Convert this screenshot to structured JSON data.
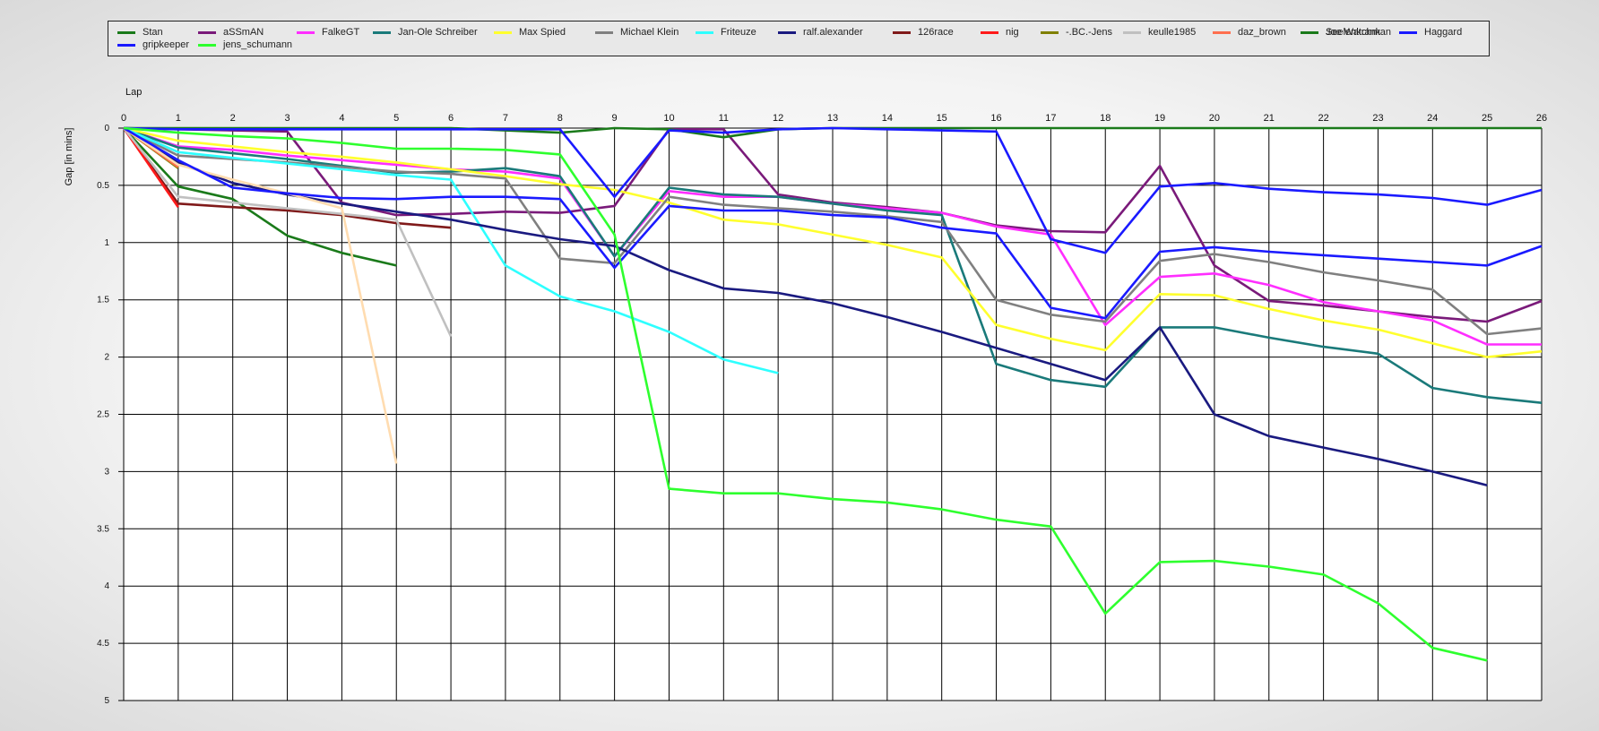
{
  "chart_data": {
    "type": "line",
    "xlabel": "Lap",
    "ylabel": "Gap [in mins]",
    "xlim": [
      0,
      26
    ],
    "ylim": [
      0,
      5
    ],
    "y_inverted": true,
    "grid": true,
    "legend_position": "top",
    "x_ticks": [
      "0",
      "1",
      "2",
      "3",
      "4",
      "5",
      "6",
      "7",
      "8",
      "9",
      "10",
      "11",
      "12",
      "13",
      "14",
      "15",
      "16",
      "17",
      "18",
      "19",
      "20",
      "21",
      "22",
      "23",
      "24",
      "25",
      "26"
    ],
    "y_ticks": [
      "0",
      "0.5",
      "1",
      "1.5",
      "2",
      "2.5",
      "3",
      "3.5",
      "4",
      "4.5",
      "5"
    ],
    "series": [
      {
        "name": "Stan",
        "color": "#1a7a1a",
        "x": [
          0,
          1,
          2,
          3,
          4,
          5
        ],
        "y": [
          0,
          0.51,
          0.62,
          0.94,
          1.09,
          1.2
        ]
      },
      {
        "name": "aSSmAN",
        "color": "#7a1a7a",
        "x": [
          0,
          1,
          2,
          3,
          4,
          5,
          6,
          7,
          8,
          9,
          10,
          11,
          12,
          13,
          14,
          15,
          16,
          17,
          18,
          19,
          20,
          21,
          22,
          23,
          24,
          25,
          26
        ],
        "y": [
          0,
          0.01,
          0.02,
          0.03,
          0.65,
          0.76,
          0.75,
          0.73,
          0.74,
          0.68,
          0.01,
          0.01,
          0.58,
          0.65,
          0.69,
          0.74,
          0.85,
          0.9,
          0.91,
          0.33,
          1.2,
          1.51,
          1.55,
          1.6,
          1.65,
          1.69,
          1.51
        ]
      },
      {
        "name": "FalkeGT",
        "color": "#ff2eff",
        "x": [
          0,
          1,
          2,
          3,
          4,
          5,
          6,
          7,
          8,
          9,
          10,
          11,
          12,
          13,
          14,
          15,
          16,
          17,
          18,
          19,
          20,
          21,
          22,
          23,
          24,
          25,
          26
        ],
        "y": [
          0,
          0.16,
          0.19,
          0.24,
          0.28,
          0.32,
          0.36,
          0.38,
          0.44,
          1.12,
          0.55,
          0.6,
          0.6,
          0.66,
          0.7,
          0.74,
          0.86,
          0.93,
          1.72,
          1.3,
          1.27,
          1.37,
          1.52,
          1.6,
          1.68,
          1.89,
          1.89
        ]
      },
      {
        "name": "Jan-Ole Schreiber",
        "color": "#1a7a7a",
        "x": [
          0,
          1,
          2,
          3,
          4,
          5,
          6,
          7,
          8,
          9,
          10,
          11,
          12,
          13,
          14,
          15,
          16,
          17,
          18,
          19,
          20,
          21,
          22,
          23,
          24,
          25,
          26
        ],
        "y": [
          0,
          0.17,
          0.22,
          0.27,
          0.33,
          0.39,
          0.38,
          0.35,
          0.42,
          1.12,
          0.52,
          0.58,
          0.6,
          0.66,
          0.72,
          0.76,
          2.06,
          2.2,
          2.26,
          1.74,
          1.74,
          1.83,
          1.91,
          1.97,
          2.27,
          2.35,
          2.4
        ]
      },
      {
        "name": "Max Spied",
        "color": "#ffff2e",
        "x": [
          0,
          1,
          2,
          3,
          4,
          5,
          6,
          7,
          8,
          9,
          10,
          11,
          12,
          13,
          14,
          15,
          16,
          17,
          18,
          19,
          20,
          21,
          22,
          23,
          24,
          25,
          26
        ],
        "y": [
          0,
          0.11,
          0.16,
          0.21,
          0.25,
          0.3,
          0.36,
          0.42,
          0.49,
          0.54,
          0.65,
          0.8,
          0.84,
          0.93,
          1.02,
          1.13,
          1.72,
          1.84,
          1.94,
          1.45,
          1.46,
          1.58,
          1.68,
          1.76,
          1.88,
          2.0,
          1.95
        ]
      },
      {
        "name": "Michael Klein",
        "color": "#808080",
        "x": [
          0,
          1,
          2,
          3,
          4,
          5,
          6,
          7,
          8,
          9,
          10,
          11,
          12,
          13,
          14,
          15,
          16,
          17,
          18,
          19,
          20,
          21,
          22,
          23,
          24,
          25,
          26
        ],
        "y": [
          0,
          0.24,
          0.27,
          0.3,
          0.34,
          0.38,
          0.4,
          0.44,
          1.14,
          1.18,
          0.6,
          0.67,
          0.7,
          0.73,
          0.77,
          0.82,
          1.5,
          1.63,
          1.69,
          1.16,
          1.1,
          1.17,
          1.26,
          1.33,
          1.41,
          1.8,
          1.75
        ]
      },
      {
        "name": "Friteuze",
        "color": "#2effff",
        "x": [
          0,
          1,
          2,
          3,
          4,
          5,
          6,
          7,
          8,
          9,
          10,
          11,
          12
        ],
        "y": [
          0,
          0.21,
          0.26,
          0.31,
          0.36,
          0.41,
          0.45,
          1.2,
          1.47,
          1.6,
          1.78,
          2.02,
          2.14
        ]
      },
      {
        "name": "ralf.alexander",
        "color": "#1a1a80",
        "x": [
          0,
          1,
          2,
          3,
          4,
          5,
          6,
          7,
          8,
          9,
          10,
          11,
          12,
          13,
          14,
          15,
          16,
          17,
          18,
          19,
          20,
          21,
          22,
          23,
          24,
          25
        ],
        "y": [
          0,
          0.3,
          0.48,
          0.58,
          0.66,
          0.73,
          0.8,
          0.89,
          0.97,
          1.03,
          1.24,
          1.4,
          1.44,
          1.53,
          1.65,
          1.78,
          1.92,
          2.06,
          2.2,
          1.74,
          2.5,
          2.69,
          2.79,
          2.89,
          3.0,
          3.12
        ]
      },
      {
        "name": "126race",
        "color": "#801a1a",
        "x": [
          0,
          1,
          2,
          3,
          4,
          5,
          6
        ],
        "y": [
          0,
          0.66,
          0.69,
          0.72,
          0.76,
          0.83,
          0.87
        ]
      },
      {
        "name": "nig",
        "color": "#ff1a1a",
        "x": [
          0,
          1
        ],
        "y": [
          0,
          0.69
        ]
      },
      {
        "name": "-.BC.-Jens",
        "color": "#808000",
        "x": [
          0,
          1
        ],
        "y": [
          0,
          0.35
        ]
      },
      {
        "name": "keulle1985",
        "color": "#c0c0c0",
        "x": [
          0,
          1,
          2,
          3,
          4,
          5,
          6
        ],
        "y": [
          0,
          0.6,
          0.65,
          0.7,
          0.75,
          0.8,
          1.82
        ]
      },
      {
        "name": "daz_brown",
        "color": "#ff6f4f",
        "x": [
          0,
          1
        ],
        "y": [
          0,
          0.34
        ]
      },
      {
        "name": "Joe Watchman",
        "color": "#ffdcb0",
        "x": [
          0,
          1,
          2,
          3,
          4,
          5
        ],
        "y": [
          0,
          0.32,
          0.45,
          0.57,
          0.7,
          2.93
        ]
      },
      {
        "name": "Seelenkrank",
        "color": "#1a7a1a",
        "x": [
          0,
          1,
          2,
          3,
          4,
          5,
          6,
          7,
          8,
          9,
          10,
          11,
          12,
          13,
          14,
          15,
          16,
          17,
          18,
          19,
          20,
          21,
          22,
          23,
          24,
          25,
          26
        ],
        "y": [
          0,
          0.0,
          0.0,
          0.0,
          0.0,
          0.0,
          0.0,
          0.02,
          0.04,
          0.0,
          0.01,
          0.08,
          0.01,
          0.0,
          0.0,
          0.0,
          0.0,
          0.0,
          0.0,
          0.0,
          0.0,
          0.0,
          0.0,
          0.0,
          0.0,
          0.0,
          0.0
        ]
      },
      {
        "name": "Haggard",
        "color": "#1a1aff",
        "x": [
          0,
          1,
          2,
          3,
          4,
          5,
          6,
          7,
          8,
          9,
          10,
          11,
          12,
          13,
          14,
          15,
          16,
          17,
          18,
          19,
          20,
          21,
          22,
          23,
          24,
          25,
          26
        ],
        "y": [
          0,
          0.01,
          0.01,
          0.01,
          0.01,
          0.01,
          0.01,
          0.01,
          0.01,
          0.6,
          0.02,
          0.04,
          0.01,
          0.0,
          0.01,
          0.02,
          0.03,
          0.97,
          1.09,
          0.51,
          0.48,
          0.53,
          0.56,
          0.58,
          0.61,
          0.67,
          0.54
        ]
      },
      {
        "name": "gripkeeper",
        "color": "#1a1aff",
        "x": [
          0,
          1,
          2,
          3,
          4,
          5,
          6,
          7,
          8,
          9,
          10,
          11,
          12,
          13,
          14,
          15,
          16,
          17,
          18,
          19,
          20,
          21,
          22,
          23,
          24,
          25,
          26
        ],
        "y": [
          0,
          0.28,
          0.52,
          0.57,
          0.61,
          0.62,
          0.6,
          0.6,
          0.62,
          1.22,
          0.68,
          0.72,
          0.72,
          0.76,
          0.78,
          0.87,
          0.92,
          1.57,
          1.66,
          1.08,
          1.04,
          1.08,
          1.11,
          1.14,
          1.17,
          1.2,
          1.03
        ]
      },
      {
        "name": "jens_schumann",
        "color": "#2eff2e",
        "x": [
          0,
          1,
          2,
          3,
          4,
          5,
          6,
          7,
          8,
          9,
          10,
          11,
          12,
          13,
          14,
          15,
          16,
          17,
          18,
          19,
          20,
          21,
          22,
          23,
          24,
          25
        ],
        "y": [
          0,
          0.04,
          0.07,
          0.09,
          0.13,
          0.18,
          0.18,
          0.19,
          0.23,
          0.93,
          3.15,
          3.19,
          3.19,
          3.24,
          3.27,
          3.33,
          3.42,
          3.48,
          4.24,
          3.79,
          3.78,
          3.83,
          3.9,
          4.15,
          4.54,
          4.65
        ]
      }
    ]
  }
}
